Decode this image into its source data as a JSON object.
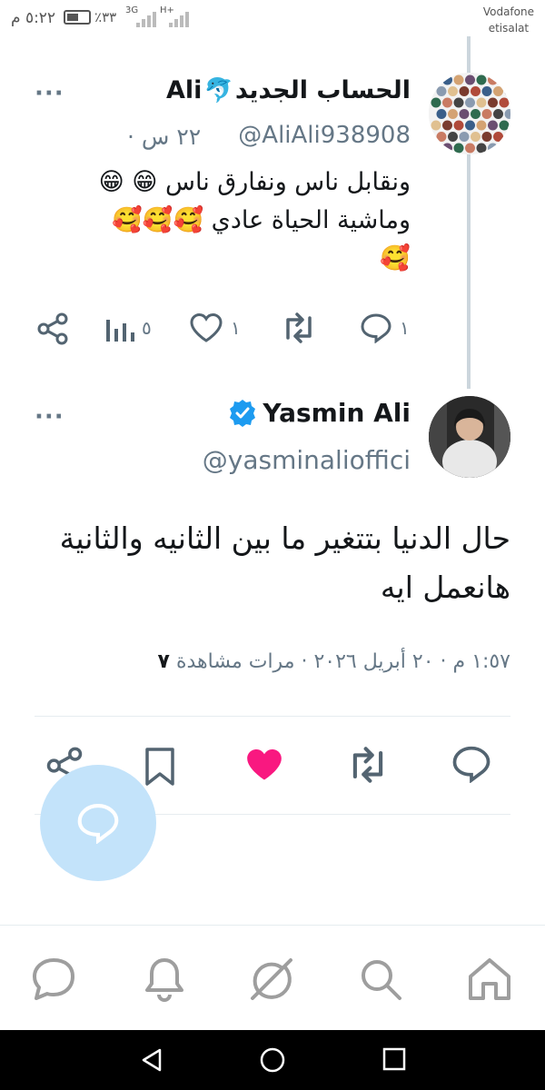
{
  "status_bar": {
    "time": "٥:٢٢ م",
    "battery": "٪٣٣",
    "network_1": "3G",
    "network_2": "H+",
    "carrier_line1": "Vodafone",
    "carrier_line2": "etisalat"
  },
  "tweet1": {
    "name_ar": "الحساب الجديد",
    "name_emoji": "🐬",
    "name_en": "Ali",
    "handle": "@AliAli938908",
    "separator": "·",
    "time": "٢٢ س",
    "body_line1": "ونقابل ناس ونفارق ناس 😁 😁",
    "body_line2": "وماشية الحياة عادي 🥰🥰🥰",
    "body_line3": "🥰",
    "reply_count": "١",
    "retweet_count": "",
    "like_count": "١",
    "analytics_count": "٥",
    "more": "···"
  },
  "tweet2": {
    "name": "Yasmin Ali",
    "handle": "@yasminalioffici",
    "body_line1": "حال الدنيا بتتغير ما بين الثانيه والثانية",
    "body_line2": "هانعمل ايه",
    "meta_time": "١:٥٧ م · ٢٠ أبريل ٢٠٢٦ · ",
    "views_count": "٧",
    "views_label": "مرات مشاهدة",
    "more": "···",
    "liked": true
  },
  "colors": {
    "text_primary": "#14171a",
    "text_secondary": "#657786",
    "icon_gray": "#536471",
    "like_pink": "#f91880",
    "verified_blue": "#1d9bf0",
    "fab_blue": "#c3e3fa",
    "divider": "#e6ecf0",
    "nav_gray": "#9e9e9e"
  },
  "icons": {
    "tweet1_actions": [
      "reply-icon",
      "retweet-icon",
      "like-icon",
      "analytics-icon",
      "share-icon"
    ],
    "tweet2_actions": [
      "reply-icon",
      "retweet-icon",
      "like-filled-icon",
      "bookmark-icon",
      "share-icon"
    ],
    "bottom_nav": [
      "home-icon",
      "search-icon",
      "spaces-icon",
      "notifications-icon",
      "messages-icon"
    ],
    "system_nav": [
      "back-icon",
      "home-circle-icon",
      "recents-icon"
    ]
  }
}
